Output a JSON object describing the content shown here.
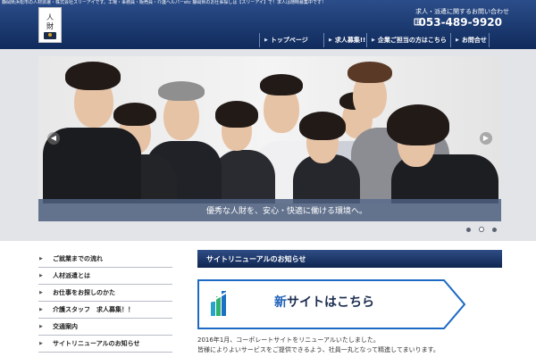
{
  "header": {
    "tagline": "静岡県浜松市の人材派遣・株式会社スリーアイです。工場・事務員・販売員・介護ヘルパーetc 静岡県のお仕事探しは【スリーアイ】で！求人は随時募集中です！",
    "logo_text": [
      "人",
      "財"
    ],
    "contact_label": "求人・派遣に関するお問い合わせ",
    "phone": "053-489-9920",
    "nav": [
      {
        "label": "トップページ"
      },
      {
        "label": "求人募集!!"
      },
      {
        "label": "企業ご担当の方はこちら"
      },
      {
        "label": "お問合せ"
      }
    ],
    "colors": {
      "header_top": "#2b4d8a",
      "header_bottom": "#102b5c"
    }
  },
  "slider": {
    "caption": "優秀な人財を、安心・快適に働ける環境へ。",
    "prev_icon": "chevron-left-icon",
    "next_icon": "chevron-right-icon",
    "dots": 3,
    "active_dot": 2
  },
  "sidebar": {
    "items": [
      {
        "label": "ご就業までの流れ"
      },
      {
        "label": "人材派遣とは"
      },
      {
        "label": "お仕事をお探しのかた"
      },
      {
        "label": "介護スタッフ　求人募集！！"
      },
      {
        "label": "交通案内"
      },
      {
        "label": "サイトリニューアルのお知らせ"
      }
    ]
  },
  "main": {
    "section_title": "サイトリニューアルのお知らせ",
    "banner_accent": "新",
    "banner_text": "サイトはこちら",
    "body": [
      "2016年1月、コーポレートサイトをリニューアルいたしました。",
      "皆様によりよいサービスをご提供できるよう、社員一丸となって精進してまいります。"
    ]
  }
}
